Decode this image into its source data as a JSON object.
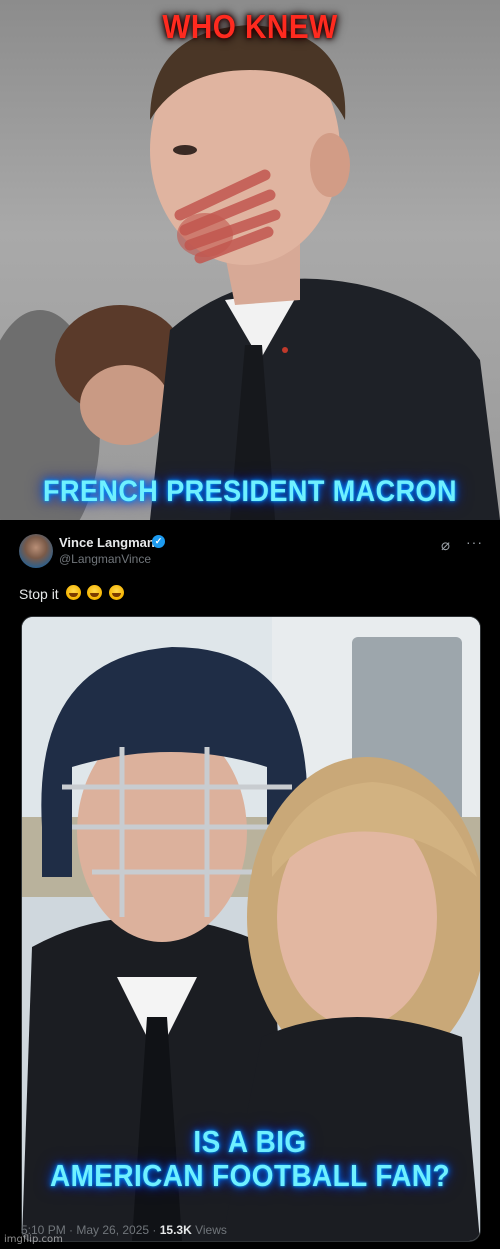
{
  "captions": {
    "top": "WHO KNEW",
    "middle": "FRENCH PRESIDENT MACRON",
    "bottom_line1": "IS A BIG",
    "bottom_line2": "AMERICAN FOOTBALL FAN?"
  },
  "tweet": {
    "author_name": "Vince Langman",
    "author_handle": "@LangmanVince",
    "text": "Stop it",
    "emojis": [
      "face-with-tears-of-joy",
      "face-with-tears-of-joy",
      "face-with-tears-of-joy"
    ],
    "time_prefix": "5:10 PM · May 26, 2025 · ",
    "views_count": "15.3K",
    "views_label": " Views"
  },
  "watermark": "imgflip.com",
  "colors": {
    "caption_red": "#ff2a1f",
    "caption_blue": "#6ff0ff",
    "verified_badge": "#1d9bf0",
    "tweet_background": "#000000"
  },
  "icons": [
    "verified-badge-icon",
    "grok-icon",
    "more-options-icon"
  ]
}
